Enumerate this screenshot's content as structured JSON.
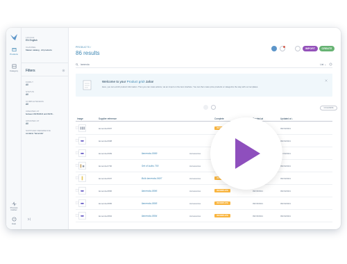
{
  "colors": {
    "accent": "#3c86b3",
    "purple": "#9452ba",
    "green": "#67b373",
    "badge": "#f9b53f",
    "play": "#8e4fbd"
  },
  "rail": {
    "items": [
      {
        "label": "Products",
        "icon": "box-icon"
      },
      {
        "label": "Category",
        "icon": "category-icon"
      },
      {
        "label": "Process tracker",
        "icon": "activity-icon"
      },
      {
        "label": "Help",
        "icon": "help-icon"
      }
    ]
  },
  "panel": {
    "locale_label": "Locale",
    "locale_value": "EN  English",
    "channel_label": "Channel",
    "channel_value": "Master catalog · All products",
    "filters_title": "Filters",
    "filters": [
      {
        "label": "Family",
        "value": "All"
      },
      {
        "label": "Status",
        "value": "All"
      },
      {
        "label": "Completeness",
        "value": "All"
      },
      {
        "label": "Created at",
        "value": "between 09/15/2021 and 09/16..."
      },
      {
        "label": "Updated at",
        "value": "All"
      },
      {
        "label": "Supplier reference",
        "value": "contains \"lamenda\""
      }
    ]
  },
  "header": {
    "breadcrumb": "PRODUCTS /",
    "results": "86 results",
    "import_label": "IMPORT",
    "create_label": "CREATE"
  },
  "search": {
    "value": "lamenda",
    "list_label": "List ⌄"
  },
  "welcome": {
    "title_prefix": "Welcome to your ",
    "title_highlight": "Product grid!",
    "title_suffix": " Jaha!",
    "body": "Here, you can enrich product information. Then you can mass actions, via an import on the item interface. You can then mass price products or categorize the stay with our templates."
  },
  "grid": {
    "columns_label": "COLUMNS",
    "headers": {
      "image": "Image",
      "supplier": "Supplier reference",
      "label": "",
      "family": "",
      "complete": "Complete",
      "created": "Created at",
      "updated": "Updated at ↓"
    },
    "rows": [
      {
        "supplier": "lamenda-0997",
        "label": "",
        "family": "",
        "complete": "INCOMPLETE",
        "created": "09/15/2021",
        "updated": "09/16/2021"
      },
      {
        "supplier": "lamenda-0998",
        "label": "",
        "family": "",
        "complete": "INCOMPLETE",
        "created": "09/15/2021",
        "updated": "09/16/2021"
      },
      {
        "supplier": "lamenda-0999",
        "label": "llamenda-0999",
        "family": "Accessories",
        "complete": "INCOMPLETE",
        "created": "09/15/2021",
        "updated": "09/16/2021"
      },
      {
        "supplier": "lamenda-0700",
        "label": "Set of bulbs 700",
        "family": "Accessories",
        "complete": "INCOMPLETE",
        "created": "09/15/2021",
        "updated": "09/16/2021"
      },
      {
        "supplier": "lamenda-0697",
        "label": "Bulb lamenda-0697",
        "family": "Accessories",
        "complete": "INCOMPLETE",
        "created": "09/15/2021",
        "updated": "09/16/2021"
      },
      {
        "supplier": "lamenda-0896",
        "label": "llamenda-0896",
        "family": "Accessories",
        "complete": "INCOMPLETE",
        "created": "09/15/2021",
        "updated": "09/16/2021"
      },
      {
        "supplier": "lamenda-0895",
        "label": "llamenda-0895",
        "family": "Accessories",
        "complete": "INCOMPLETE",
        "created": "09/15/2021",
        "updated": "09/16/2021"
      },
      {
        "supplier": "lamenda-0894",
        "label": "llamenda-0894",
        "family": "Accessories",
        "complete": "INCOMPLETE",
        "created": "09/15/2021",
        "updated": "09/16/2021"
      }
    ]
  }
}
